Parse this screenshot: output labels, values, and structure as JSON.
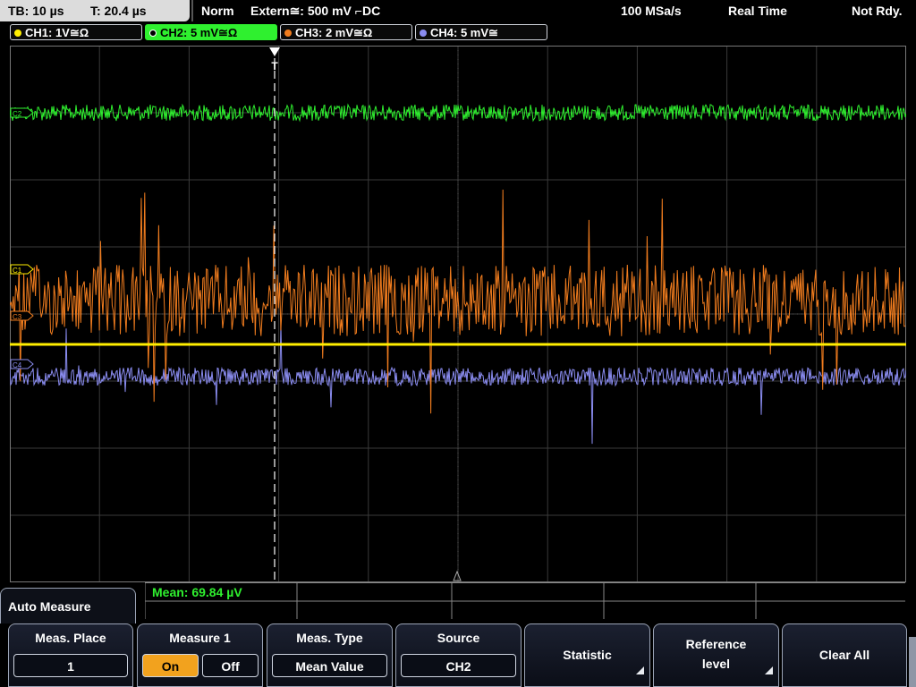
{
  "status": {
    "timebase": "TB: 10 µs",
    "trigger_time": "T: 20.4 µs",
    "trigger_mode": "Norm",
    "trigger_source": "Extern≅: 500 mV ⌐DC",
    "sample_rate": "100 MSa/s",
    "acq_mode": "Real Time",
    "state": "Not Rdy."
  },
  "channels": [
    {
      "label": "CH1: 1V≅Ω",
      "color": "#ffee00",
      "marker": "C1"
    },
    {
      "label": "CH2: 5 mV≅Ω",
      "color": "#2ff02f",
      "marker": "C2"
    },
    {
      "label": "CH3: 2 mV≅Ω",
      "color": "#f07c1e",
      "marker": "C3"
    },
    {
      "label": "CH4: 5 mV≅",
      "color": "#8a8cf0",
      "marker": "C4"
    }
  ],
  "trigger_marker": "T",
  "measurement": {
    "result": "Mean: 69.84 µV"
  },
  "menu": {
    "title": "Auto Measure",
    "meas_place": {
      "title": "Meas. Place",
      "value": "1"
    },
    "measure1": {
      "title": "Measure 1",
      "on": "On",
      "off": "Off"
    },
    "meas_type": {
      "title": "Meas. Type",
      "value": "Mean Value"
    },
    "source": {
      "title": "Source",
      "value": "CH2"
    },
    "statistic": {
      "title": "Statistic"
    },
    "reference": {
      "title_line1": "Reference",
      "title_line2": "level"
    },
    "clear_all": {
      "title": "Clear All"
    }
  }
}
